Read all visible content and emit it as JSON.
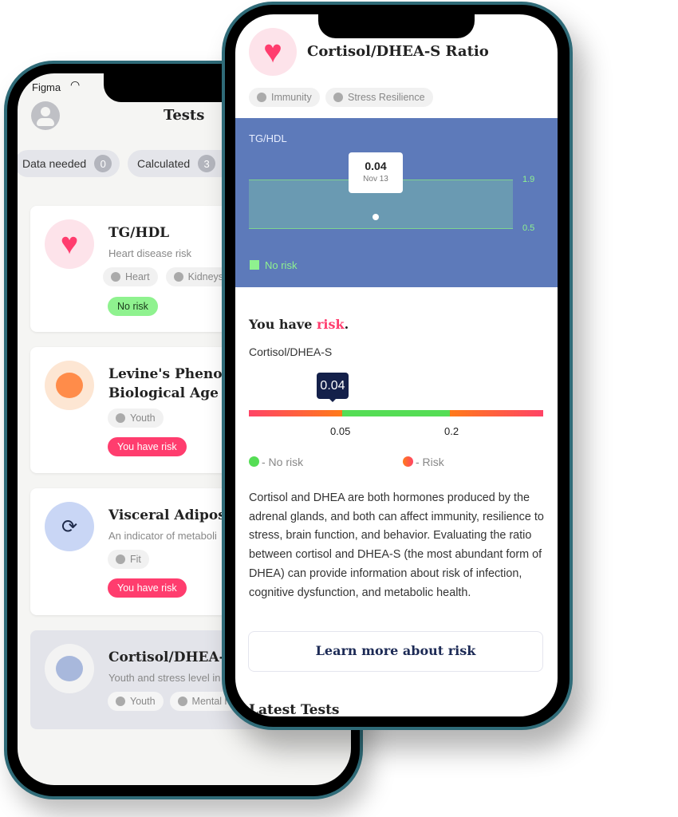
{
  "back_phone": {
    "status_carrier": "Figma",
    "title": "Tests",
    "filters": [
      {
        "label": "Data needed",
        "count": "0"
      },
      {
        "label": "Calculated",
        "count": "3"
      }
    ],
    "cards": [
      {
        "title": "TG/HDL",
        "subtitle": "Heart disease risk",
        "tags": [
          "Heart",
          "Kidneys"
        ],
        "status": "No risk"
      },
      {
        "title": "Levine's Phenot",
        "title2": "Biological Age",
        "tags": [
          "Youth"
        ],
        "status": "You have risk"
      },
      {
        "title": "Visceral Adiposity",
        "subtitle": "An indicator of metaboli",
        "tags": [
          "Fit"
        ],
        "status": "You have risk"
      },
      {
        "title": "Cortisol/DHEA-S",
        "subtitle": "Youth and stress level in",
        "tags": [
          "Youth",
          "Mental h"
        ]
      }
    ]
  },
  "front_phone": {
    "title": "Cortisol/DHEA-S Ratio",
    "tags": [
      "Immunity",
      "Stress Resilience"
    ],
    "chart": {
      "label": "TG/HDL",
      "tooltip_value": "0.04",
      "tooltip_date": "Nov 13",
      "range_high": "1.9",
      "range_low": "0.5",
      "legend": "No risk"
    },
    "result": {
      "prefix": "You have ",
      "highlight": "risk",
      "suffix": ".",
      "metric": "Cortisol/DHEA-S",
      "value": "0.04",
      "thresholds": [
        "0.05",
        "0.2"
      ],
      "legend_no_risk": "- No risk",
      "legend_risk": "- Risk"
    },
    "description": "Cortisol and DHEA are both hormones produced by the adrenal glands, and both can affect immunity, resilience to stress, brain function, and behavior. Evaluating the ratio between cortisol and DHEA-S (the most abundant form of DHEA) can provide information about risk of infection, cognitive dysfunction, and metabolic health.",
    "cta": "Learn more about risk",
    "next_section": "Latest Tests"
  },
  "colors": {
    "risk": "#ff3d6e",
    "no_risk": "#8ff28f",
    "chart_bg": "#5d7aba",
    "green": "#55dd55",
    "orange": "#ff7a1a",
    "navy": "#14204a",
    "frame": "#2f6b78"
  }
}
